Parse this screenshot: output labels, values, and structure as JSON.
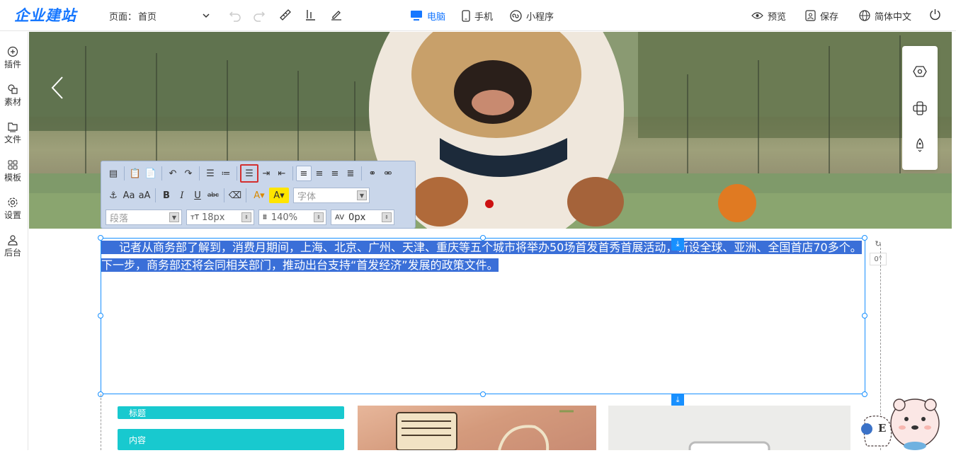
{
  "topbar": {
    "logo": "企业建站",
    "page_label": "页面：",
    "page_value": "首页",
    "devices": [
      {
        "label": "电脑",
        "icon": "monitor-icon",
        "active": true
      },
      {
        "label": "手机",
        "icon": "phone-icon",
        "active": false
      },
      {
        "label": "小程序",
        "icon": "mini-program-icon",
        "active": false
      }
    ],
    "preview": "预览",
    "save": "保存",
    "language": "简体中文"
  },
  "sidebar": {
    "items": [
      {
        "label": "插件",
        "icon": "plus-circle-icon"
      },
      {
        "label": "素材",
        "icon": "shapes-icon"
      },
      {
        "label": "文件",
        "icon": "folder-icon"
      },
      {
        "label": "模板",
        "icon": "grid-icon"
      },
      {
        "label": "设置",
        "icon": "gear-icon"
      },
      {
        "label": "后台",
        "icon": "user-icon"
      }
    ]
  },
  "editor_toolbar": {
    "font_placeholder": "字体",
    "paragraph": "段落",
    "font_size": "18px",
    "line_height": "140%",
    "letter_spacing": "0px",
    "font_size_prefix": "тT"
  },
  "textbox": {
    "text": "记者从商务部了解到，消费月期间，上海、北京、广州、天津、重庆等五个城市将举办50场首发首秀首展活动，新设全球、亚洲、全国首店70多个。下一步，商务部还将会同相关部门，推动出台支持“首发经济”发展的政策文件。",
    "rotation": "0°"
  },
  "content_blocks": {
    "title": "标题",
    "content": "内容"
  },
  "mascot": {
    "letter": "E"
  },
  "colors": {
    "accent": "#1677ff",
    "teal": "#18c9cf",
    "selection": "#3a6fd8"
  }
}
